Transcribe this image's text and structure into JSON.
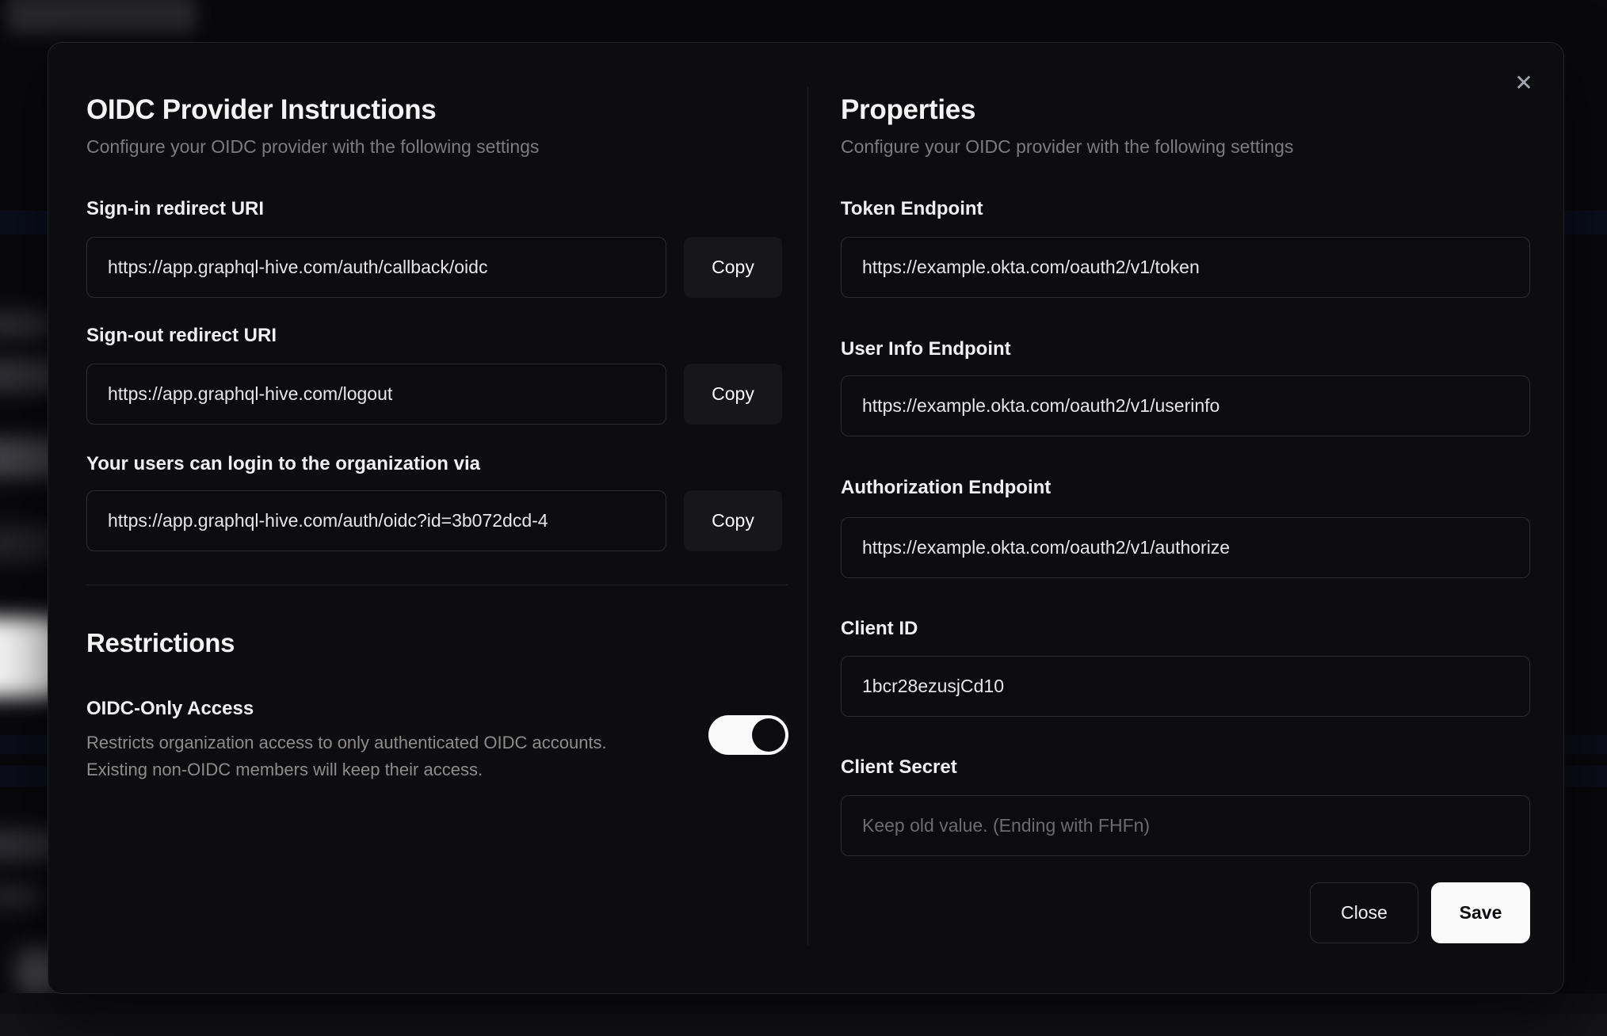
{
  "modal": {
    "close_icon": "✕",
    "left": {
      "title": "OIDC Provider Instructions",
      "subtitle": "Configure your OIDC provider with the following settings",
      "fields": [
        {
          "label": "Sign-in redirect URI",
          "value": "https://app.graphql-hive.com/auth/callback/oidc",
          "copy_label": "Copy"
        },
        {
          "label": "Sign-out redirect URI",
          "value": "https://app.graphql-hive.com/logout",
          "copy_label": "Copy"
        },
        {
          "label": "Your users can login to the organization via",
          "value": "https://app.graphql-hive.com/auth/oidc?id=3b072dcd-4",
          "copy_label": "Copy"
        }
      ],
      "restrictions": {
        "title": "Restrictions",
        "toggle_label": "OIDC-Only Access",
        "toggle_description_line1": "Restricts organization access to only authenticated OIDC accounts.",
        "toggle_description_line2": "Existing non-OIDC members will keep their access.",
        "toggle_on": true
      }
    },
    "right": {
      "title": "Properties",
      "subtitle": "Configure your OIDC provider with the following settings",
      "fields": [
        {
          "label": "Token Endpoint",
          "value": "https://example.okta.com/oauth2/v1/token"
        },
        {
          "label": "User Info Endpoint",
          "value": "https://example.okta.com/oauth2/v1/userinfo"
        },
        {
          "label": "Authorization Endpoint",
          "value": "https://example.okta.com/oauth2/v1/authorize"
        },
        {
          "label": "Client ID",
          "value": "1bcr28ezusjCd10"
        },
        {
          "label": "Client Secret",
          "value": "",
          "placeholder": "Keep old value. (Ending with FHFn)"
        }
      ],
      "buttons": {
        "close": "Close",
        "save": "Save"
      }
    },
    "colors": {
      "modal_bg": "#0d0d10",
      "save_button_bg": "#fafafa",
      "toggle_on_track": "#fafafa",
      "input_border": "#2f2d2a",
      "accent_text": "#f4f4f5",
      "muted_text": "#7c7b81"
    }
  }
}
